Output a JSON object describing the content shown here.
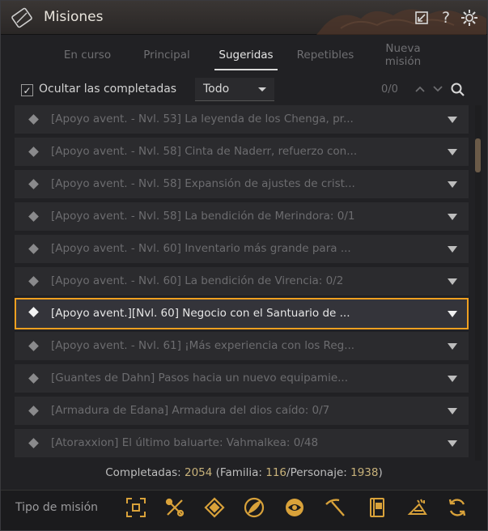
{
  "window": {
    "title": "Misiones"
  },
  "tabs": [
    {
      "label": "En curso",
      "active": false
    },
    {
      "label": "Principal",
      "active": false
    },
    {
      "label": "Sugeridas",
      "active": true
    },
    {
      "label": "Repetibles",
      "active": false
    },
    {
      "label": "Nueva\nmisión",
      "active": false
    }
  ],
  "filter": {
    "hide_completed_label": "Ocultar las completadas",
    "hide_completed_checked": true,
    "dropdown_value": "Todo",
    "search_count": "0/0"
  },
  "quests": [
    {
      "text": "[Apoyo avent. - Nvl. 53] La leyenda de los Chenga, pr..."
    },
    {
      "text": "[Apoyo avent. - Nvl. 58] Cinta de Naderr, refuerzo con..."
    },
    {
      "text": "[Apoyo avent. - Nvl. 58] Expansión de ajustes de crist..."
    },
    {
      "text": "[Apoyo avent. - Nvl. 58] La bendición de Merindora: 0/1"
    },
    {
      "text": "[Apoyo avent. - Nvl. 60] Inventario más grande para ..."
    },
    {
      "text": "[Apoyo avent. - Nvl. 60] La bendición de Virencia: 0/2"
    },
    {
      "text": "[Apoyo avent.][Nvl. 60] Negocio con el Santuario de ...",
      "selected": true
    },
    {
      "text": "[Apoyo avent. - Nvl. 61] ¡Más experiencia con los Reg..."
    },
    {
      "text": "[Guantes de Dahn] Pasos hacia un nuevo equipamie..."
    },
    {
      "text": "[Armadura de Edana] Armadura del dios caído: 0/7"
    },
    {
      "text": "[Atoraxxion] El último baluarte: Vahmalkea: 0/48"
    }
  ],
  "stats": {
    "completed_label": "Completadas: ",
    "completed": "2054",
    "family_label": " (Familia: ",
    "family": "116",
    "personal_label": "/Personaje: ",
    "personal": "1938",
    "close": ")"
  },
  "bottom": {
    "type_label": "Tipo de misión",
    "icons": [
      "target-icon",
      "tools-icon",
      "compass-icon",
      "feather-icon",
      "orb-icon",
      "pickaxe-icon",
      "book-icon",
      "horn-icon",
      "refresh-icon"
    ]
  },
  "colors": {
    "accent": "#f0a020",
    "icon_gold": "#d9a23a"
  }
}
